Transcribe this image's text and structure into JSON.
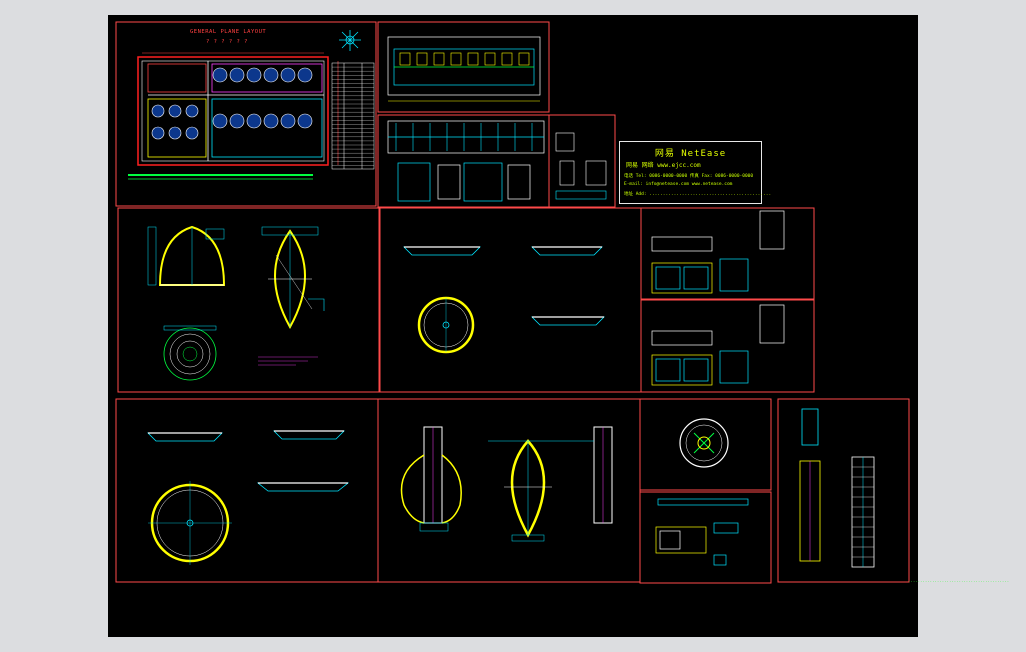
{
  "canvas": {
    "background": "#000000"
  },
  "plan_title": "GENERAL  PLANE  LAYOUT",
  "plan_subtitle": "? ? ? ? ? ?",
  "brand": {
    "name": "网易 NetEase",
    "sub": "网易 网络  www.ejcc.com",
    "line1": "电话 Tel: 0086-0000-0000  传真 Fax: 0086-0000-0000",
    "line2": "E-mail: info@netease.com  www.netease.com",
    "line3": "地址 Add: ............................................."
  },
  "side_text": "..........................................",
  "colors": {
    "frame": "#ff4a4a",
    "cyan": "#00e5ff",
    "yellow": "#ffff00",
    "green": "#00ff40",
    "white": "#ffffff",
    "magenta": "#ff40ff",
    "red": "#ff2020"
  }
}
